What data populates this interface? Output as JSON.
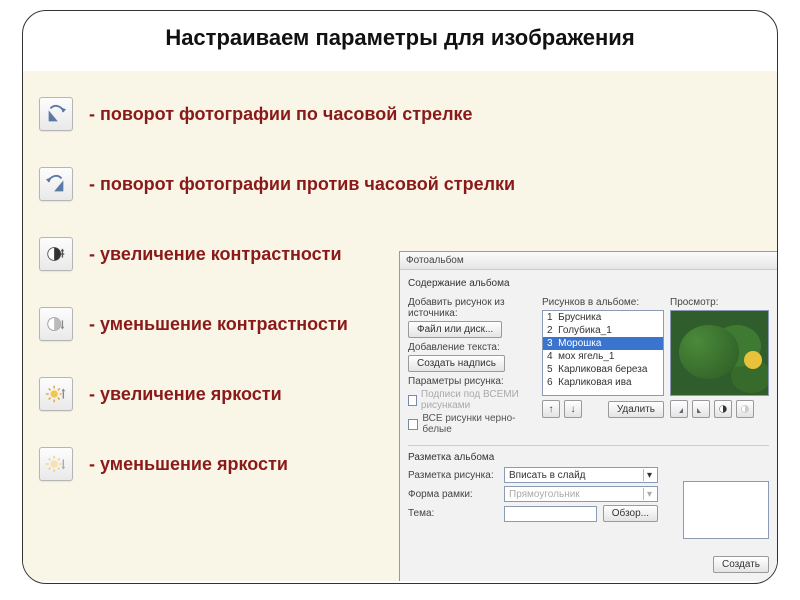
{
  "title": "Настраиваем параметры для изображения",
  "rows": [
    {
      "label": "- поворот фотографии по часовой стрелке"
    },
    {
      "label": "- поворот фотографии против часовой стрелки"
    },
    {
      "label": "- увеличение контрастности"
    },
    {
      "label": "- уменьшение контрастности"
    },
    {
      "label": "- увеличение яркости"
    },
    {
      "label": "- уменьшение яркости"
    }
  ],
  "dialog": {
    "title": "Фотоальбом",
    "group_content": "Содержание альбома",
    "add_from_label": "Добавить рисунок из источника:",
    "file_disk_btn": "Файл или диск...",
    "add_text_label": "Добавление текста:",
    "create_caption_btn": "Создать надпись",
    "params_label": "Параметры рисунка:",
    "chk_captions": "Подписи под ВСЕМИ рисунками",
    "chk_bw": "ВСЕ рисунки черно-белые",
    "list_header": "Рисунков в альбоме:",
    "preview_header": "Просмотр:",
    "items": [
      {
        "idx": "1",
        "name": "Брусника"
      },
      {
        "idx": "2",
        "name": "Голубика_1"
      },
      {
        "idx": "3",
        "name": "Морошка"
      },
      {
        "idx": "4",
        "name": "мох ягель_1"
      },
      {
        "idx": "5",
        "name": "Карликовая береза"
      },
      {
        "idx": "6",
        "name": "Карликовая ива"
      }
    ],
    "up": "↑",
    "down": "↓",
    "remove_btn": "Удалить",
    "layout_group": "Разметка альбома",
    "layout_label": "Разметка рисунка:",
    "layout_value": "Вписать в слайд",
    "frame_label": "Форма рамки:",
    "frame_value": "Прямоугольник",
    "theme_label": "Тема:",
    "theme_value": "",
    "browse_btn": "Обзор...",
    "create_btn": "Создать"
  }
}
